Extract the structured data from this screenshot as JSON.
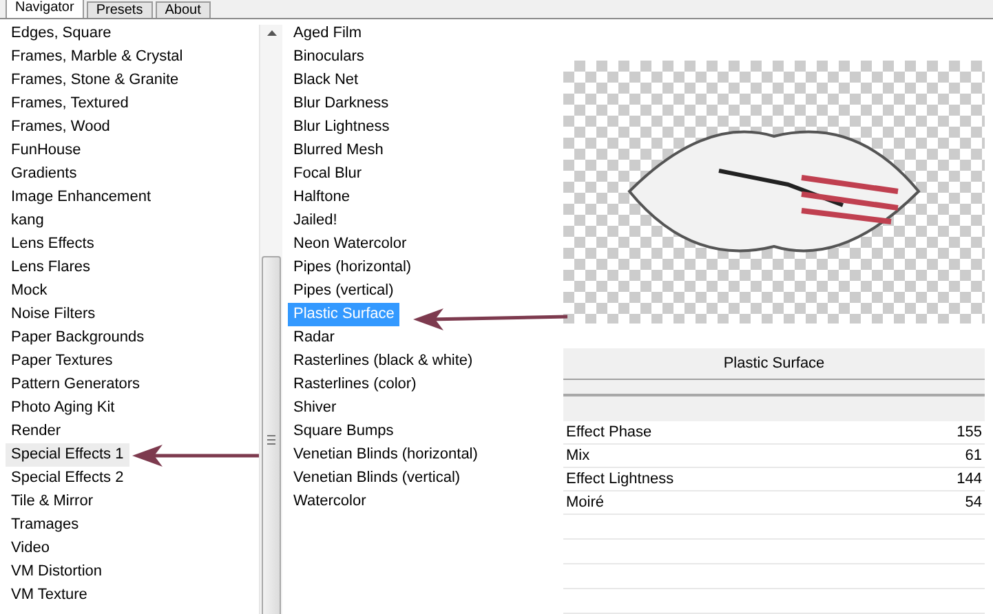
{
  "tabs": [
    {
      "label": "Navigator",
      "selected": true
    },
    {
      "label": "Presets",
      "selected": false
    },
    {
      "label": "About",
      "selected": false
    }
  ],
  "categories": [
    {
      "label": "Edges, Square",
      "selected": false
    },
    {
      "label": "Frames, Marble & Crystal",
      "selected": false
    },
    {
      "label": "Frames, Stone & Granite",
      "selected": false
    },
    {
      "label": "Frames, Textured",
      "selected": false
    },
    {
      "label": "Frames, Wood",
      "selected": false
    },
    {
      "label": "FunHouse",
      "selected": false
    },
    {
      "label": "Gradients",
      "selected": false
    },
    {
      "label": "Image Enhancement",
      "selected": false
    },
    {
      "label": "kang",
      "selected": false
    },
    {
      "label": "Lens Effects",
      "selected": false
    },
    {
      "label": "Lens Flares",
      "selected": false
    },
    {
      "label": "Mock",
      "selected": false
    },
    {
      "label": "Noise Filters",
      "selected": false
    },
    {
      "label": "Paper Backgrounds",
      "selected": false
    },
    {
      "label": "Paper Textures",
      "selected": false
    },
    {
      "label": "Pattern Generators",
      "selected": false
    },
    {
      "label": "Photo Aging Kit",
      "selected": false
    },
    {
      "label": "Render",
      "selected": false
    },
    {
      "label": "Special Effects 1",
      "selected": true
    },
    {
      "label": "Special Effects 2",
      "selected": false
    },
    {
      "label": "Tile & Mirror",
      "selected": false
    },
    {
      "label": "Tramages",
      "selected": false
    },
    {
      "label": "Video",
      "selected": false
    },
    {
      "label": "VM Distortion",
      "selected": false
    },
    {
      "label": "VM Texture",
      "selected": false
    }
  ],
  "filters": [
    {
      "label": "Aged Film",
      "selected": false
    },
    {
      "label": "Binoculars",
      "selected": false
    },
    {
      "label": "Black Net",
      "selected": false
    },
    {
      "label": "Blur Darkness",
      "selected": false
    },
    {
      "label": "Blur Lightness",
      "selected": false
    },
    {
      "label": "Blurred Mesh",
      "selected": false
    },
    {
      "label": "Focal Blur",
      "selected": false
    },
    {
      "label": "Halftone",
      "selected": false
    },
    {
      "label": "Jailed!",
      "selected": false
    },
    {
      "label": "Neon Watercolor",
      "selected": false
    },
    {
      "label": "Pipes (horizontal)",
      "selected": false
    },
    {
      "label": "Pipes (vertical)",
      "selected": false
    },
    {
      "label": "Plastic Surface",
      "selected": true
    },
    {
      "label": "Radar",
      "selected": false
    },
    {
      "label": "Rasterlines (black & white)",
      "selected": false
    },
    {
      "label": "Rasterlines (color)",
      "selected": false
    },
    {
      "label": "Shiver",
      "selected": false
    },
    {
      "label": "Square Bumps",
      "selected": false
    },
    {
      "label": "Venetian Blinds (horizontal)",
      "selected": false
    },
    {
      "label": "Venetian Blinds (vertical)",
      "selected": false
    },
    {
      "label": "Watercolor",
      "selected": false
    }
  ],
  "filter_title": "Plastic Surface",
  "parameters": [
    {
      "name": "Effect Phase",
      "value": "155"
    },
    {
      "name": "Mix",
      "value": "61"
    },
    {
      "name": "Effect Lightness",
      "value": "144"
    },
    {
      "name": "Moiré",
      "value": "54"
    }
  ]
}
